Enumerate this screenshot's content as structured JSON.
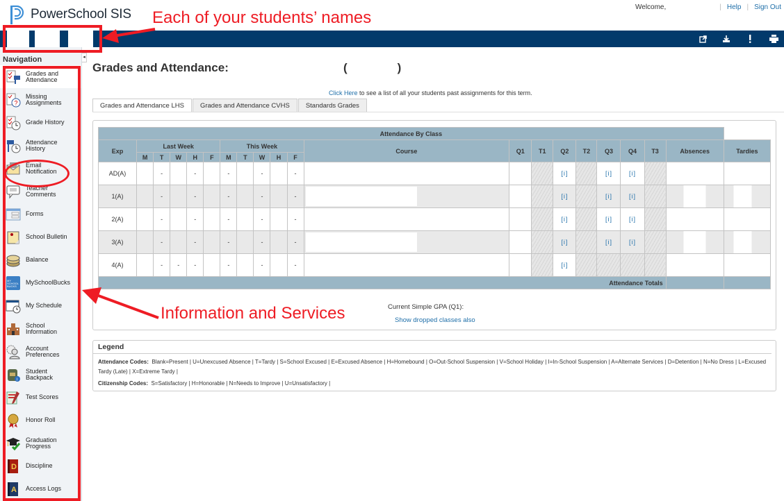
{
  "header": {
    "app_name": "PowerSchool SIS",
    "welcome": "Welcome,",
    "links": [
      "Help",
      "Sign Out"
    ],
    "nav_icons": [
      "external-link-icon",
      "download-icon",
      "alert-icon",
      "print-icon"
    ]
  },
  "annotations": {
    "students_names": "Each of your students’ names",
    "information_services": "Information and Services"
  },
  "sidebar": {
    "title": "Navigation",
    "items": [
      {
        "label": "Grades and Attendance",
        "icon": "grades-attendance-icon",
        "active": true
      },
      {
        "label": "Missing Assignments",
        "icon": "missing-assignments-icon"
      },
      {
        "label": "Grade History",
        "icon": "grade-history-icon"
      },
      {
        "label": "Attendance History",
        "icon": "attendance-history-icon"
      },
      {
        "label": "Email Notification",
        "icon": "email-icon"
      },
      {
        "label": "Teacher Comments",
        "icon": "comment-icon"
      },
      {
        "label": "Forms",
        "icon": "forms-icon"
      },
      {
        "label": "School Bulletin",
        "icon": "bulletin-icon"
      },
      {
        "label": "Balance",
        "icon": "balance-icon"
      },
      {
        "label": "MySchoolBucks",
        "icon": "myschoolbucks-icon"
      },
      {
        "label": "My Schedule",
        "icon": "schedule-icon"
      },
      {
        "label": "School Information",
        "icon": "school-icon"
      },
      {
        "label": "Account Preferences",
        "icon": "account-icon"
      },
      {
        "label": "Student Backpack",
        "icon": "backpack-icon"
      },
      {
        "label": "Test Scores",
        "icon": "test-scores-icon"
      },
      {
        "label": "Honor Roll",
        "icon": "honor-roll-icon"
      },
      {
        "label": "Graduation Progress",
        "icon": "graduation-icon"
      },
      {
        "label": "Discipline",
        "icon": "discipline-icon"
      },
      {
        "label": "Access Logs",
        "icon": "access-logs-icon"
      }
    ]
  },
  "main": {
    "title": "Grades and Attendance:",
    "title_suffix": "(          )",
    "click_here": "Click Here",
    "click_here_rest": " to see a list of all your students past assignments for this term.",
    "tabs": [
      {
        "label": "Grades and Attendance LHS",
        "active": true
      },
      {
        "label": "Grades and Attendance CVHS"
      },
      {
        "label": "Standards Grades"
      }
    ],
    "table": {
      "caption": "Attendance By Class",
      "headers": {
        "exp": "Exp",
        "last_week": "Last Week",
        "this_week": "This Week",
        "days": [
          "M",
          "T",
          "W",
          "H",
          "F"
        ],
        "course": "Course",
        "terms": [
          "Q1",
          "T1",
          "Q2",
          "T2",
          "Q3",
          "Q4",
          "T3"
        ],
        "absences": "Absences",
        "tardies": "Tardies"
      },
      "rows": [
        {
          "exp": "AD(A)",
          "last_week": [
            "",
            "-",
            "",
            "-",
            ""
          ],
          "this_week": [
            "-",
            "",
            "-",
            "",
            "-"
          ],
          "Q2": "[i]",
          "Q3": "[i]",
          "Q4": "[i]"
        },
        {
          "exp": "1(A)",
          "last_week": [
            "",
            "-",
            "",
            "-",
            ""
          ],
          "this_week": [
            "-",
            "",
            "-",
            "",
            "-"
          ],
          "Q2": "[i]",
          "Q3": "[i]",
          "Q4": "[i]"
        },
        {
          "exp": "2(A)",
          "last_week": [
            "",
            "-",
            "",
            "-",
            ""
          ],
          "this_week": [
            "-",
            "",
            "-",
            "",
            "-"
          ],
          "Q2": "[i]",
          "Q3": "[i]",
          "Q4": "[i]"
        },
        {
          "exp": "3(A)",
          "last_week": [
            "",
            "-",
            "",
            "-",
            ""
          ],
          "this_week": [
            "-",
            "",
            "-",
            "",
            "-"
          ],
          "Q2": "[i]",
          "Q3": "[i]",
          "Q4": "[i]"
        },
        {
          "exp": "4(A)",
          "last_week": [
            "",
            "-",
            "-",
            "-",
            ""
          ],
          "this_week": [
            "-",
            "",
            "-",
            "",
            "-"
          ],
          "Q2": "[i]",
          "Q3": "",
          "Q4": ""
        }
      ],
      "totals_label": "Attendance Totals"
    },
    "gpa": "Current Simple GPA (Q1):",
    "show_dropped": "Show dropped classes also"
  },
  "legend": {
    "title": "Legend",
    "attendance_label": "Attendance Codes:",
    "attendance_codes": "Blank=Present | U=Unexcused Absence | T=Tardy | S=School Excused | E=Excused Absence | H=Homebound | O=Out-School Suspension | V=School Holiday | I=In-School Suspension | A=Alternate Services | D=Detention | N=No Dress | L=Excused Tardy (Late) | X=Extreme Tardy |",
    "citizenship_label": "Citizenship Codes:",
    "citizenship_codes": "S=Satisfactory | H=Honorable | N=Needs to Improve | U=Unsatisfactory |"
  }
}
